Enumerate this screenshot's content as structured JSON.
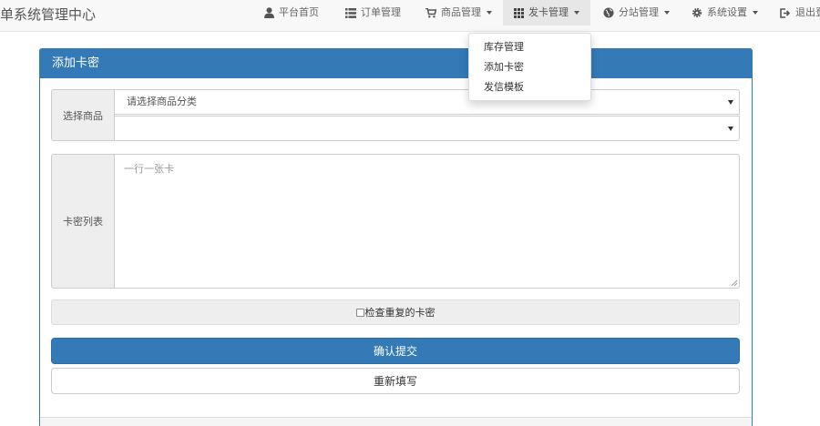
{
  "app": {
    "title": "单系统管理中心"
  },
  "nav": {
    "home": "平台首页",
    "orders": "订单管理",
    "products": "商品管理",
    "cards": "发卡管理",
    "substation": "分站管理",
    "settings": "系统设置",
    "logout": "退出登"
  },
  "dropdown": {
    "items": [
      "库存管理",
      "添加卡密",
      "发信模板"
    ]
  },
  "panel": {
    "title": "添加卡密"
  },
  "form": {
    "product_label": "选择商品",
    "category_select_value": "请选择商品分类",
    "product_select_value": "",
    "cards_label": "卡密列表",
    "cards_placeholder": "一行一张卡",
    "check_duplicate_label": "检查重复的卡密",
    "check_duplicate_checked": false,
    "submit_label": "确认提交",
    "reset_label": "重新填写"
  },
  "colors": {
    "primary": "#337ab7",
    "navbar_bg": "#f8f8f8",
    "active_nav_bg": "#e7e7e7",
    "addon_bg": "#eeeeee"
  }
}
